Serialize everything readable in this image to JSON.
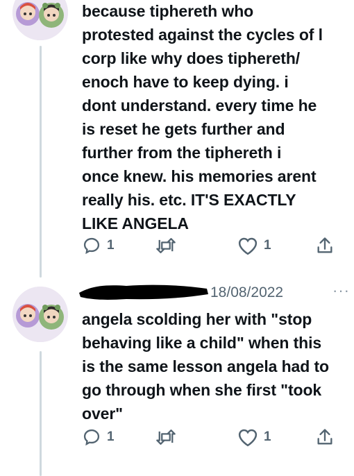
{
  "tweets": [
    {
      "text": "because tiphereth who\nprotested against the cycles of l\ncorp like why does tiphereth/\nenoch have to keep dying. i\ndont understand. every time he\nis reset he gets further and\nfurther from the tiphereth i\nonce knew. his memories arent\nreally his. etc. IT'S EXACTLY\nLIKE ANGELA",
      "actions": {
        "reply_count": "1",
        "retweet_count": "",
        "like_count": "1"
      }
    },
    {
      "date": "18/08/2022",
      "more": "···",
      "text": "angela scolding her with \"stop\nbehaving like a child\" when this\nis the same lesson angela had to\ngo through when she first \"took\nover\"",
      "actions": {
        "reply_count": "1",
        "retweet_count": "",
        "like_count": "1"
      }
    }
  ],
  "icons": [
    "reply-icon",
    "retweet-icon",
    "like-icon",
    "share-icon"
  ],
  "colors": {
    "text": "#0f1419",
    "muted": "#536471",
    "thread": "#cfd9de",
    "redaction": "#000000"
  }
}
